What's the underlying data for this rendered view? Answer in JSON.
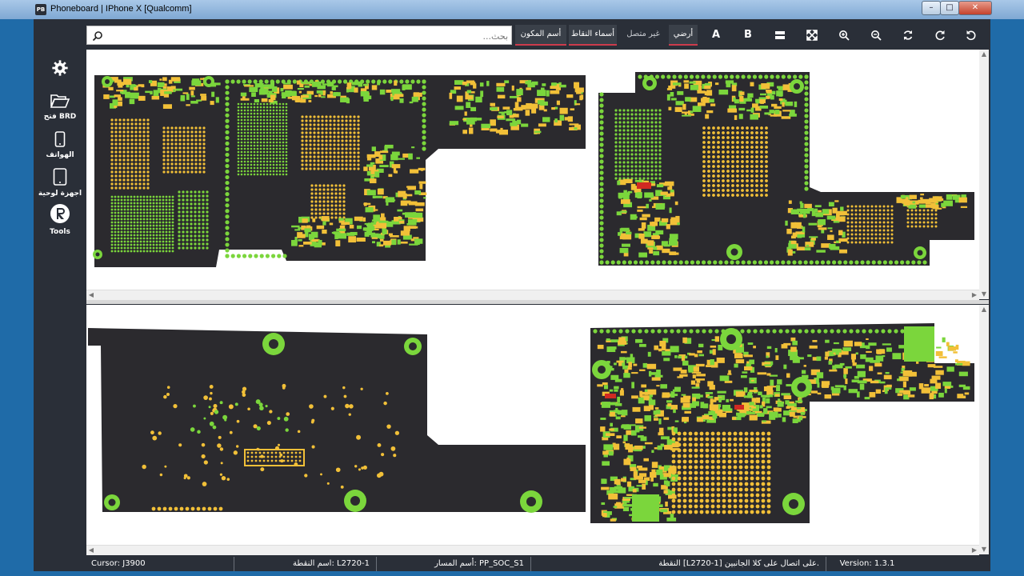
{
  "window": {
    "icon_text": "PB",
    "title": "Phoneboard | IPhone X [Qualcomm]"
  },
  "sidebar": {
    "items": [
      {
        "label": "",
        "icon": "gear-icon"
      },
      {
        "label": "فتح BRD",
        "icon": "folder-open-icon"
      },
      {
        "label": "الهواتف",
        "icon": "phone-icon"
      },
      {
        "label": "اجهزة لوحية",
        "icon": "tablet-icon"
      },
      {
        "label": "Tools",
        "icon": "tools-logo-icon"
      }
    ]
  },
  "toolbar": {
    "search_placeholder": "بحث...",
    "filters": [
      {
        "label": "أسم المكون",
        "underline_color": "#cc3b4c"
      },
      {
        "label": "أسماء النقاط",
        "underline_color": "#cc3b4c"
      },
      {
        "label": "غير متصل"
      },
      {
        "label": "أرضي",
        "underline_color": "#cc3b4c"
      }
    ],
    "icons": [
      {
        "label": "A",
        "icon": "side-a-icon"
      },
      {
        "label": "B",
        "icon": "side-b-icon"
      },
      {
        "label": "",
        "icon": "split-view-icon"
      },
      {
        "label": "",
        "icon": "fit-screen-icon"
      },
      {
        "label": "",
        "icon": "zoom-in-icon"
      },
      {
        "label": "",
        "icon": "zoom-out-icon"
      },
      {
        "label": "",
        "icon": "refresh-icon"
      },
      {
        "label": "",
        "icon": "rotate-cw-icon"
      },
      {
        "label": "",
        "icon": "rotate-ccw-icon"
      }
    ]
  },
  "colors": {
    "board": "#2b2a2e",
    "pad_green": "#7bd63c",
    "pad_yellow": "#f2c038",
    "pad_red": "#d12a22",
    "accent": "#cc3b4c"
  },
  "status": {
    "cursor": "Cursor: J3900",
    "point_name": "اسم النقطة: L2720-1",
    "net_name": "أسم المسار: PP_SOC_S1",
    "message": "النقطة [L2720-1] على اتصال على كلا الجانبين.",
    "version": "Version: 1.3.1"
  }
}
